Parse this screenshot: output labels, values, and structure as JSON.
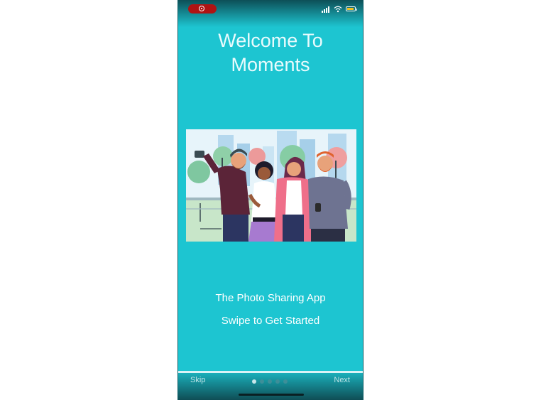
{
  "app": {
    "title_line1": "Welcome To",
    "title_line2": "Moments",
    "subtitle": "The Photo Sharing App",
    "instruction": "Swipe to Get Started"
  },
  "illustration": {
    "description_icon": "friends-selfie-illustration"
  },
  "status_bar": {
    "icons": [
      "screen-recording-icon",
      "signal-icon",
      "wifi-icon",
      "battery-icon"
    ]
  },
  "navigation": {
    "skip_label": "Skip",
    "next_label": "Next",
    "page_count": 5,
    "current_page": 1
  },
  "colors": {
    "background": "#1dc5d1",
    "recording": "#b01313"
  }
}
